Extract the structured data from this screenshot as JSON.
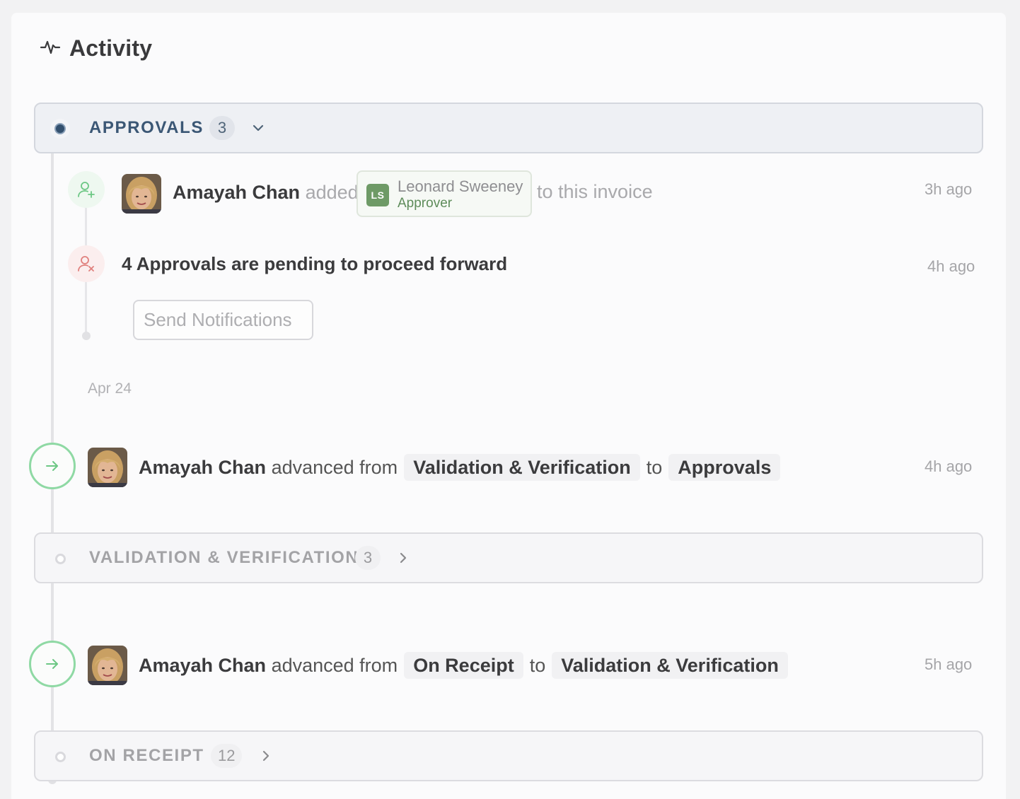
{
  "header": {
    "title": "Activity"
  },
  "sections": [
    {
      "title": "APPROVALS",
      "count": "3",
      "state": "expanded"
    },
    {
      "title": "VALIDATION & VERIFICATION",
      "count": "3",
      "state": "collapsed"
    },
    {
      "title": "ON RECEIPT",
      "count": "12",
      "state": "collapsed"
    }
  ],
  "approvals_events": [
    {
      "actor": "Amayah Chan",
      "verb": "added",
      "person": {
        "initials": "LS",
        "name": "Leonard Sweeney",
        "role": "Approver"
      },
      "suffix": "to this invoice",
      "time": "3h ago"
    },
    {
      "message": "4 Approvals are pending to proceed forward",
      "time": "4h ago",
      "action_label": "Send Notifications"
    }
  ],
  "date_label": "Apr 24",
  "transitions": [
    {
      "actor": "Amayah Chan",
      "verb": "advanced from",
      "from": "Validation & Verification",
      "connector": "to",
      "to": "Approvals",
      "time": "4h ago"
    },
    {
      "actor": "Amayah Chan",
      "verb": "advanced from",
      "from": "On Receipt",
      "connector": "to",
      "to": "Validation & Verification",
      "time": "5h ago"
    }
  ],
  "colors": {
    "accent_green": "#8fd9a4",
    "approvals_blue": "#3b5775",
    "chip_green": "#6e9a66"
  },
  "icons": [
    "activity-icon",
    "user-plus-icon",
    "user-x-icon",
    "arrow-right-icon",
    "chevron-down-icon",
    "chevron-right-icon"
  ]
}
